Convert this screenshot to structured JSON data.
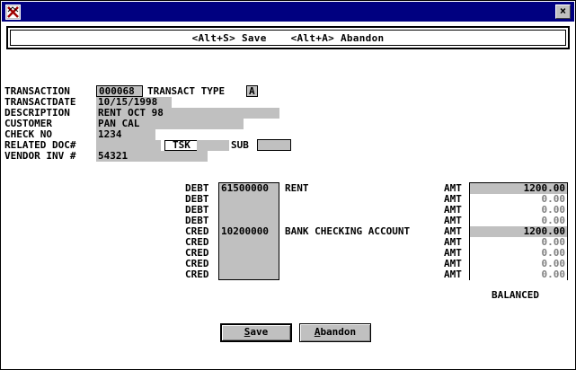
{
  "window": {
    "close_glyph": "×"
  },
  "hint": {
    "save": "<Alt+S> Save",
    "abandon": "<Alt+A> Abandon"
  },
  "header": {
    "transaction_label": "TRANSACTION",
    "transaction_value": "000068",
    "transact_type_label": "TRANSACT TYPE",
    "transact_type_value": "A",
    "transactdate_label": "TRANSACTDATE",
    "transactdate_value": "10/15/1998",
    "description_label": "DESCRIPTION",
    "description_value": "RENT OCT 98",
    "customer_label": "CUSTOMER",
    "customer_value": "PAN CAL",
    "check_no_label": "CHECK NO",
    "check_no_value": "1234",
    "related_doc_label": "RELATED DOC#",
    "related_doc_value": "",
    "tsk_label": "TSK",
    "tsk_value": "",
    "sub_label": "SUB",
    "sub_value": "",
    "vendor_inv_label": "VENDOR INV #",
    "vendor_inv_value": "54321"
  },
  "lines": [
    {
      "type": "DEBT",
      "account": "61500000",
      "desc": "RENT",
      "amt_label": "AMT",
      "amount": "1200.00"
    },
    {
      "type": "DEBT",
      "account": "",
      "desc": "",
      "amt_label": "AMT",
      "amount": "0.00"
    },
    {
      "type": "DEBT",
      "account": "",
      "desc": "",
      "amt_label": "AMT",
      "amount": "0.00"
    },
    {
      "type": "DEBT",
      "account": "",
      "desc": "",
      "amt_label": "AMT",
      "amount": "0.00"
    },
    {
      "type": "CRED",
      "account": "10200000",
      "desc": "BANK CHECKING ACCOUNT",
      "amt_label": "AMT",
      "amount": "1200.00"
    },
    {
      "type": "CRED",
      "account": "",
      "desc": "",
      "amt_label": "AMT",
      "amount": "0.00"
    },
    {
      "type": "CRED",
      "account": "",
      "desc": "",
      "amt_label": "AMT",
      "amount": "0.00"
    },
    {
      "type": "CRED",
      "account": "",
      "desc": "",
      "amt_label": "AMT",
      "amount": "0.00"
    },
    {
      "type": "CRED",
      "account": "",
      "desc": "",
      "amt_label": "AMT",
      "amount": "0.00"
    }
  ],
  "status": "BALANCED",
  "buttons": {
    "save_mnemonic": "S",
    "save_rest": "ave",
    "abandon_mnemonic": "A",
    "abandon_rest": "bandon"
  },
  "colors": {
    "titlebar": "#000080",
    "field": "#c0c0c0",
    "muted_amount": "#808080"
  }
}
